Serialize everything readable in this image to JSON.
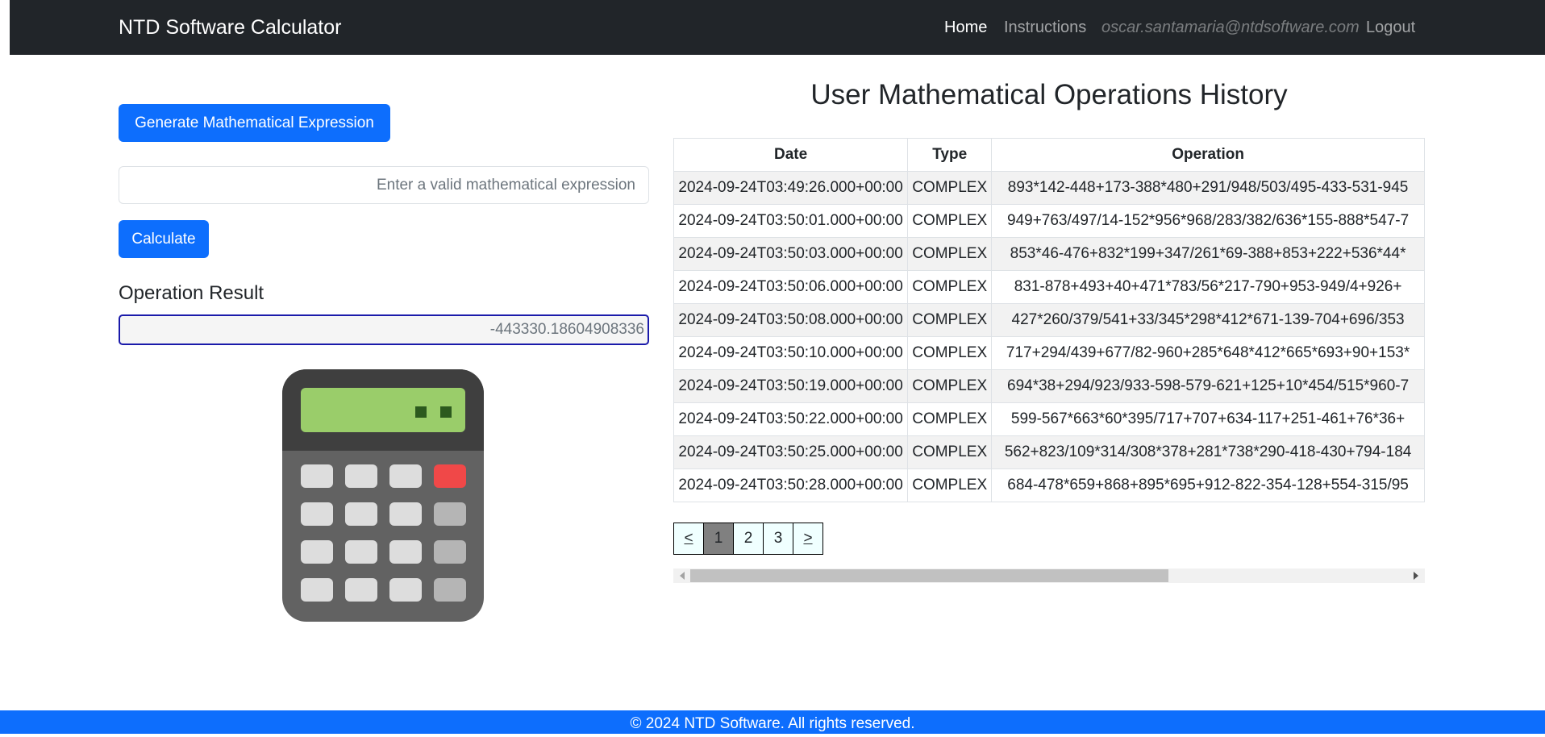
{
  "nav": {
    "brand": "NTD Software Calculator",
    "home": "Home",
    "instructions": "Instructions",
    "email": "oscar.santamaria@ntdsoftware.com",
    "logout": "Logout"
  },
  "calculator": {
    "generate_label": "Generate Mathematical Expression",
    "input_value": "",
    "input_placeholder": "Enter a valid mathematical expression",
    "calculate_label": "Calculate",
    "result_heading": "Operation Result",
    "result_value": "-443330.18604908336"
  },
  "history": {
    "title": "User Mathematical Operations History",
    "columns": [
      "Date",
      "Type",
      "Operation"
    ],
    "rows": [
      {
        "date": "2024-09-24T03:49:26.000+00:00",
        "type": "COMPLEX",
        "operation": "893*142-448+173-388*480+291/948/503/495-433-531-945"
      },
      {
        "date": "2024-09-24T03:50:01.000+00:00",
        "type": "COMPLEX",
        "operation": "949+763/497/14-152*956*968/283/382/636*155-888*547-7"
      },
      {
        "date": "2024-09-24T03:50:03.000+00:00",
        "type": "COMPLEX",
        "operation": "853*46-476+832*199+347/261*69-388+853+222+536*44*"
      },
      {
        "date": "2024-09-24T03:50:06.000+00:00",
        "type": "COMPLEX",
        "operation": "831-878+493+40+471*783/56*217-790+953-949/4+926+"
      },
      {
        "date": "2024-09-24T03:50:08.000+00:00",
        "type": "COMPLEX",
        "operation": "427*260/379/541+33/345*298*412*671-139-704+696/353"
      },
      {
        "date": "2024-09-24T03:50:10.000+00:00",
        "type": "COMPLEX",
        "operation": "717+294/439+677/82-960+285*648*412*665*693+90+153*"
      },
      {
        "date": "2024-09-24T03:50:19.000+00:00",
        "type": "COMPLEX",
        "operation": "694*38+294/923/933-598-579-621+125+10*454/515*960-7"
      },
      {
        "date": "2024-09-24T03:50:22.000+00:00",
        "type": "COMPLEX",
        "operation": "599-567*663*60*395/717+707+634-117+251-461+76*36+"
      },
      {
        "date": "2024-09-24T03:50:25.000+00:00",
        "type": "COMPLEX",
        "operation": "562+823/109*314/308*378+281*738*290-418-430+794-184"
      },
      {
        "date": "2024-09-24T03:50:28.000+00:00",
        "type": "COMPLEX",
        "operation": "684-478*659+868+895*695+912-822-354-128+554-315/95"
      }
    ]
  },
  "pagination": {
    "prev": "<",
    "pages": [
      "1",
      "2",
      "3"
    ],
    "active_page": "1",
    "next": ">"
  },
  "footer": {
    "text": "© 2024 NTD Software. All rights reserved."
  },
  "colors": {
    "navbar_bg": "#212529",
    "primary": "#0d6efd",
    "result_border": "#1a1aaa",
    "calc_screen": "#9acd6a",
    "calc_red_key": "#f04848"
  },
  "icons": {
    "calculator_illustration": "calculator-icon"
  }
}
